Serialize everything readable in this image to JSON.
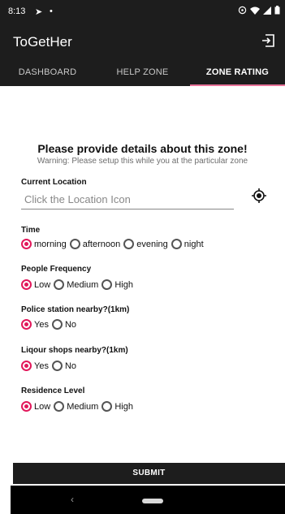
{
  "status_bar": {
    "time": "8:13",
    "nav_glyph": "➤",
    "dot": "•",
    "icons": [
      "alarm-icon",
      "wifi-icon",
      "signal-icon",
      "battery-icon"
    ]
  },
  "app_bar": {
    "title": "ToGetHer",
    "logout_icon": "logout-icon"
  },
  "tabs": [
    {
      "label": "DASHBOARD",
      "active": false
    },
    {
      "label": "HELP ZONE",
      "active": false
    },
    {
      "label": "ZONE RATING",
      "active": true
    }
  ],
  "accent_color": "#e2185b",
  "form": {
    "heading": "Please provide details about this zone!",
    "warning": "Warning: Please setup this while you at the particular zone",
    "location": {
      "label": "Current Location",
      "placeholder": "Click the Location Icon",
      "value": ""
    },
    "time": {
      "label": "Time",
      "options": [
        "morning",
        "afternoon",
        "evening",
        "night"
      ],
      "selected": "morning"
    },
    "people_frequency": {
      "label": "People Frequency",
      "options": [
        "Low",
        "Medium",
        "High"
      ],
      "selected": "Low"
    },
    "police_station": {
      "label": "Police station nearby?(1km)",
      "options": [
        "Yes",
        "No"
      ],
      "selected": "Yes"
    },
    "liquor_shops": {
      "label": "Liqour shops nearby?(1km)",
      "options": [
        "Yes",
        "No"
      ],
      "selected": "Yes"
    },
    "residence_level": {
      "label": "Residence Level",
      "options": [
        "Low",
        "Medium",
        "High"
      ],
      "selected": "Low"
    },
    "submit_label": "SUBMIT"
  },
  "nav_bar": {
    "back_glyph": "‹"
  }
}
